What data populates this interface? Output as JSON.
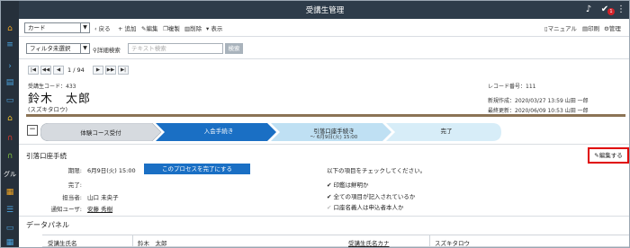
{
  "app": {
    "title": "受講生管理",
    "notification_count": "1"
  },
  "rail": {
    "label_gru": "グル"
  },
  "toolbar": {
    "view_select": "カード",
    "back": "戻る",
    "add": "追加",
    "edit": "編集",
    "copy": "複製",
    "delete": "削除",
    "display": "表示",
    "manual": "マニュアル",
    "print": "印刷",
    "admin": "管理"
  },
  "filter": {
    "select": "フィルタ未選択",
    "detail_search": "詳細検索",
    "search_placeholder": "テキスト検索",
    "search_button": "検索"
  },
  "pager": {
    "position": "1 / 94"
  },
  "record": {
    "code": "受講生コード：433",
    "name": "鈴木　太郎",
    "kana": "(スズキタロウ)",
    "record_number": "レコード番号：111",
    "created": "新規作成：2020/03/27 13:59 山田 一郎",
    "updated": "最終更新：2020/06/09 10:53 山田 一郎"
  },
  "process": {
    "steps": [
      {
        "label": "体験コース受付",
        "sub": ""
      },
      {
        "label": "入会手続き",
        "sub": ""
      },
      {
        "label": "引落口座手続き",
        "sub": "～ 6月9日(火) 15:00"
      },
      {
        "label": "完了",
        "sub": ""
      }
    ],
    "current_index": 1
  },
  "task": {
    "title": "引落口座手続",
    "edit_button": "編集する",
    "deadline_label": "期限:",
    "deadline_value": "6月9日(火) 15:00",
    "complete_button": "このプロセスを完了にする",
    "done_label": "完了:",
    "done_value": "",
    "assignee_label": "担当者:",
    "assignee_value": "山口 未央子",
    "notify_label": "通知ユーザ:",
    "notify_value": "安藤 秀樹",
    "check_intro": "以下の項目をチェックしてください。",
    "checks": [
      {
        "text": "印鑑は鮮明か",
        "checked": true
      },
      {
        "text": "全ての項目が記入されているか",
        "checked": true
      },
      {
        "text": "口座名義人は申込者本人か",
        "checked": false
      }
    ]
  },
  "data_panel": {
    "title": "データパネル",
    "row": {
      "label1": "受講生氏名",
      "value1": "鈴木　太郎",
      "label2": "受講生氏名カナ",
      "value2": "スズキタロウ"
    }
  },
  "colors": {
    "rail": "#26303b",
    "titlebar": "#2e3c4a",
    "step_active": "#1a6fc4",
    "step_done": "#d6dadf",
    "step_next": "#bfe0f3",
    "step_future": "#d7edf8",
    "accent_red": "#e00000"
  }
}
